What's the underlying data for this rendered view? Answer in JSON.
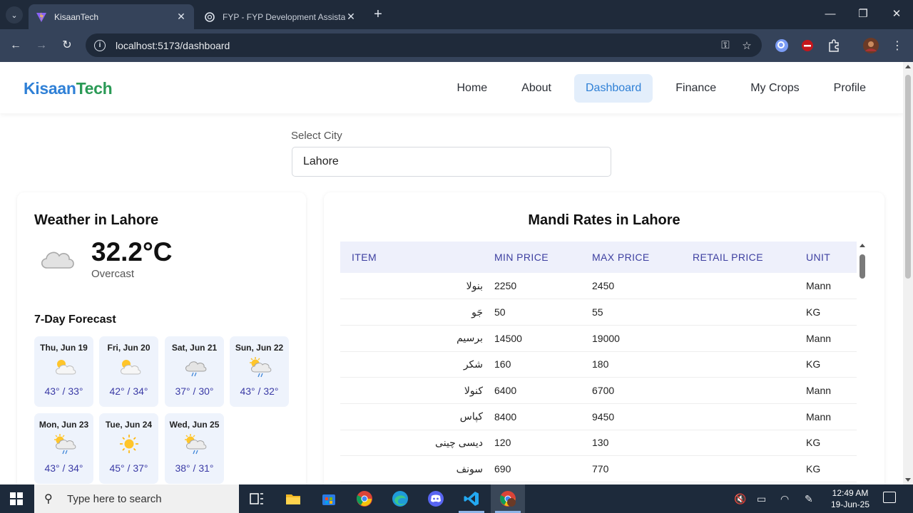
{
  "browser": {
    "tabs": [
      {
        "title": "KisaanTech",
        "active": true
      },
      {
        "title": "FYP - FYP Development Assistan",
        "active": false
      }
    ],
    "url": "localhost:5173/dashboard",
    "window_controls": {
      "minimize": "—",
      "restore": "❐",
      "close": "✕"
    }
  },
  "app": {
    "logo": {
      "part1": "Kisaan",
      "part2": "Tech"
    },
    "nav": [
      {
        "label": "Home",
        "active": false
      },
      {
        "label": "About",
        "active": false
      },
      {
        "label": "Dashboard",
        "active": true
      },
      {
        "label": "Finance",
        "active": false
      },
      {
        "label": "My Crops",
        "active": false
      },
      {
        "label": "Profile",
        "active": false
      }
    ],
    "city_select": {
      "label": "Select City",
      "value": "Lahore"
    }
  },
  "weather": {
    "title": "Weather in Lahore",
    "current": {
      "temp": "32.2°C",
      "condition": "Overcast",
      "icon": "cloud-icon"
    },
    "forecast_title": "7-Day Forecast",
    "days": [
      {
        "label": "Thu, Jun 19",
        "temp": "43° / 33°",
        "icon": "partly-cloudy-icon"
      },
      {
        "label": "Fri, Jun 20",
        "temp": "42° / 34°",
        "icon": "partly-cloudy-icon"
      },
      {
        "label": "Sat, Jun 21",
        "temp": "37° / 30°",
        "icon": "rain-icon"
      },
      {
        "label": "Sun, Jun 22",
        "temp": "43° / 32°",
        "icon": "sun-rain-icon"
      },
      {
        "label": "Mon, Jun 23",
        "temp": "43° / 34°",
        "icon": "sun-rain-icon"
      },
      {
        "label": "Tue, Jun 24",
        "temp": "45° / 37°",
        "icon": "sun-icon"
      },
      {
        "label": "Wed, Jun 25",
        "temp": "38° / 31°",
        "icon": "sun-rain-icon"
      }
    ]
  },
  "mandi": {
    "title": "Mandi Rates in Lahore",
    "columns": [
      "ITEM",
      "MIN PRICE",
      "MAX PRICE",
      "RETAIL PRICE",
      "UNIT"
    ],
    "rows": [
      {
        "item": "بنولا",
        "min": "2250",
        "max": "2450",
        "retail": "",
        "unit": "Mann"
      },
      {
        "item": "جَو",
        "min": "50",
        "max": "55",
        "retail": "",
        "unit": "KG"
      },
      {
        "item": "برسیم",
        "min": "14500",
        "max": "19000",
        "retail": "",
        "unit": "Mann"
      },
      {
        "item": "شکر",
        "min": "160",
        "max": "180",
        "retail": "",
        "unit": "KG"
      },
      {
        "item": "کنولا",
        "min": "6400",
        "max": "6700",
        "retail": "",
        "unit": "Mann"
      },
      {
        "item": "کپاس",
        "min": "8400",
        "max": "9450",
        "retail": "",
        "unit": "Mann"
      },
      {
        "item": "دیسی چینی",
        "min": "120",
        "max": "130",
        "retail": "",
        "unit": "KG"
      },
      {
        "item": "سونف",
        "min": "690",
        "max": "770",
        "retail": "",
        "unit": "KG"
      }
    ]
  },
  "taskbar": {
    "search_placeholder": "Type here to search",
    "time": "12:49 AM",
    "date": "19-Jun-25"
  },
  "colors": {
    "accent": "#2f80d6",
    "logo_green": "#2b9a56",
    "card_tile": "#eef3fc",
    "table_header": "#eef0fb"
  }
}
